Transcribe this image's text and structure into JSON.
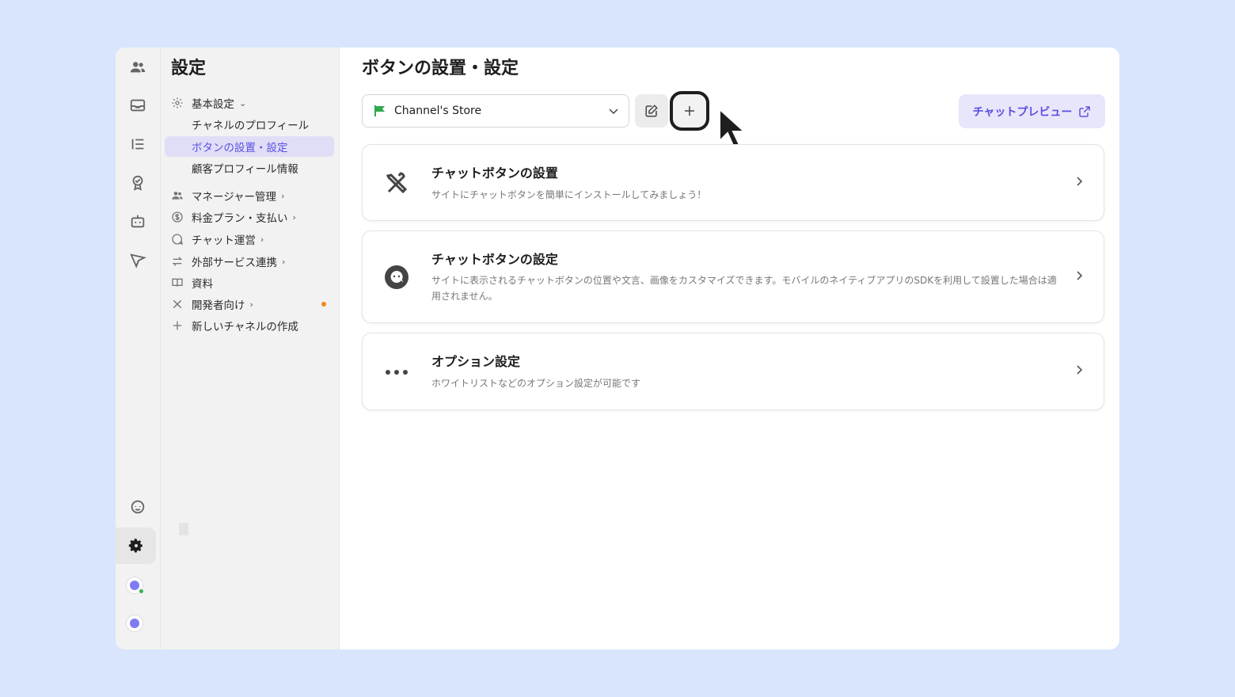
{
  "panel": {
    "title": "設定",
    "items": [
      {
        "label": "基本設定",
        "icon": "gear-icon",
        "chevron": "⌄"
      },
      {
        "label": "チャネルのプロフィール"
      },
      {
        "label": "ボタンの設置・設定"
      },
      {
        "label": "顧客プロフィール情報"
      },
      {
        "label": "マネージャー管理",
        "icon": "people-icon",
        "chevron": "›"
      },
      {
        "label": "料金プラン・支払い",
        "icon": "dollar-icon",
        "chevron": "›"
      },
      {
        "label": "チャット運営",
        "icon": "chat-icon",
        "chevron": "›"
      },
      {
        "label": "外部サービス連携",
        "icon": "arrows-icon",
        "chevron": "›"
      },
      {
        "label": "資料",
        "icon": "book-icon"
      },
      {
        "label": "開発者向け",
        "icon": "tools-icon",
        "chevron": "›"
      },
      {
        "label": "新しいチャネルの作成",
        "icon": "plus-icon"
      }
    ]
  },
  "main": {
    "title": "ボタンの設置・設定",
    "channel": "Channel's Store",
    "preview_label": "チャットプレビュー",
    "cards": [
      {
        "title": "チャットボタンの設置",
        "desc": "サイトにチャットボタンを簡単にインストールしてみましょう！",
        "icon": "tools-icon"
      },
      {
        "title": "チャットボタンの設定",
        "desc": "サイトに表示されるチャットボタンの位置や文言、画像をカスタマイズできます。モバイルのネイティブアプリのSDKを利用して設置した場合は適用されません。",
        "icon": "chat-bubble-icon"
      },
      {
        "title": "オプション設定",
        "desc": "ホワイトリストなどのオプション設定が可能です",
        "icon": "more-icon"
      }
    ]
  },
  "colors": {
    "accent": "#5a50e0",
    "background": "#d8e5fc",
    "notification": "#f28a15",
    "online": "#2fb35a"
  }
}
